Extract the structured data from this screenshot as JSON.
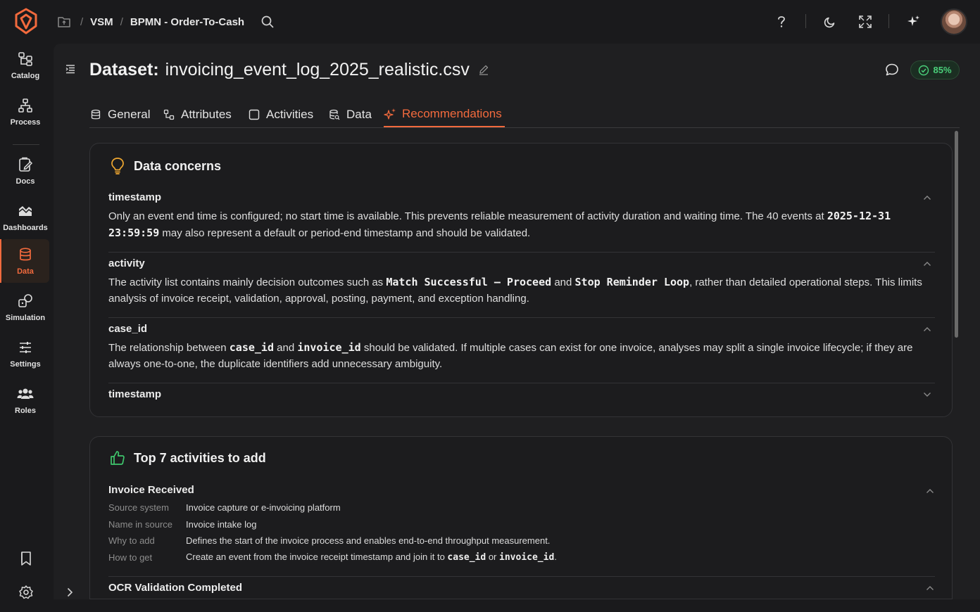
{
  "breadcrumb": {
    "items": [
      "VSM",
      "BPMN - Order-To-Cash"
    ]
  },
  "nav": {
    "items": [
      {
        "label": "Catalog",
        "icon": "catalog-icon"
      },
      {
        "label": "Process",
        "icon": "process-icon"
      },
      {
        "label": "Docs",
        "icon": "docs-icon"
      },
      {
        "label": "Dashboards",
        "icon": "dashboards-icon"
      },
      {
        "label": "Data",
        "icon": "database-icon",
        "active": true
      },
      {
        "label": "Simulation",
        "icon": "simulation-icon"
      },
      {
        "label": "Settings",
        "icon": "sliders-icon"
      },
      {
        "label": "Roles",
        "icon": "users-icon"
      }
    ]
  },
  "header": {
    "title_label": "Dataset:",
    "title_value": "invoicing_event_log_2025_realistic.csv",
    "score": "85%"
  },
  "tabs": [
    {
      "label": "General"
    },
    {
      "label": "Attributes"
    },
    {
      "label": "Activities"
    },
    {
      "label": "Data"
    },
    {
      "label": "Recommendations",
      "active": true
    }
  ],
  "concerns": {
    "title": "Data concerns",
    "items": [
      {
        "title": "timestamp",
        "text_1": "Only an event end time is configured; no start time is available. This prevents reliable measurement of activity duration and waiting time. The 40 events at ",
        "code_1": "2025-12-31 23:59:59",
        "text_2": " may also represent a default or period-end timestamp and should be validated."
      },
      {
        "title": "activity",
        "text_1": "The activity list contains mainly decision outcomes such as ",
        "code_1": "Match Successful – Proceed",
        "text_2": " and ",
        "code_2": "Stop Reminder Loop",
        "text_3": ", rather than detailed operational steps. This limits analysis of invoice receipt, validation, approval, posting, payment, and exception handling."
      },
      {
        "title": "case_id",
        "text_1": "The relationship between ",
        "code_1": "case_id",
        "text_2": " and ",
        "code_2": "invoice_id",
        "text_3": " should be validated. If multiple cases can exist for one invoice, analyses may split a single invoice lifecycle; if they are always one-to-one, the duplicate identifiers add unnecessary ambiguity."
      },
      {
        "title": "timestamp"
      }
    ]
  },
  "activities": {
    "title": "Top 7 activities to add",
    "items": [
      {
        "title": "Invoice Received",
        "rows": [
          {
            "key": "Source system",
            "value": "Invoice capture or e-invoicing platform"
          },
          {
            "key": "Name in source",
            "value": "Invoice intake log"
          },
          {
            "key": "Why to add",
            "value": "Defines the start of the invoice process and enables end-to-end throughput measurement."
          },
          {
            "key": "How to get",
            "value_1": "Create an event from the invoice receipt timestamp and join it to ",
            "code_1": "case_id",
            "value_2": " or ",
            "code_2": "invoice_id",
            "value_3": "."
          }
        ]
      },
      {
        "title": "OCR Validation Completed"
      }
    ]
  },
  "colors": {
    "accent": "#f26a3d",
    "success": "#4ad07a",
    "background": "#1a1a1c"
  }
}
